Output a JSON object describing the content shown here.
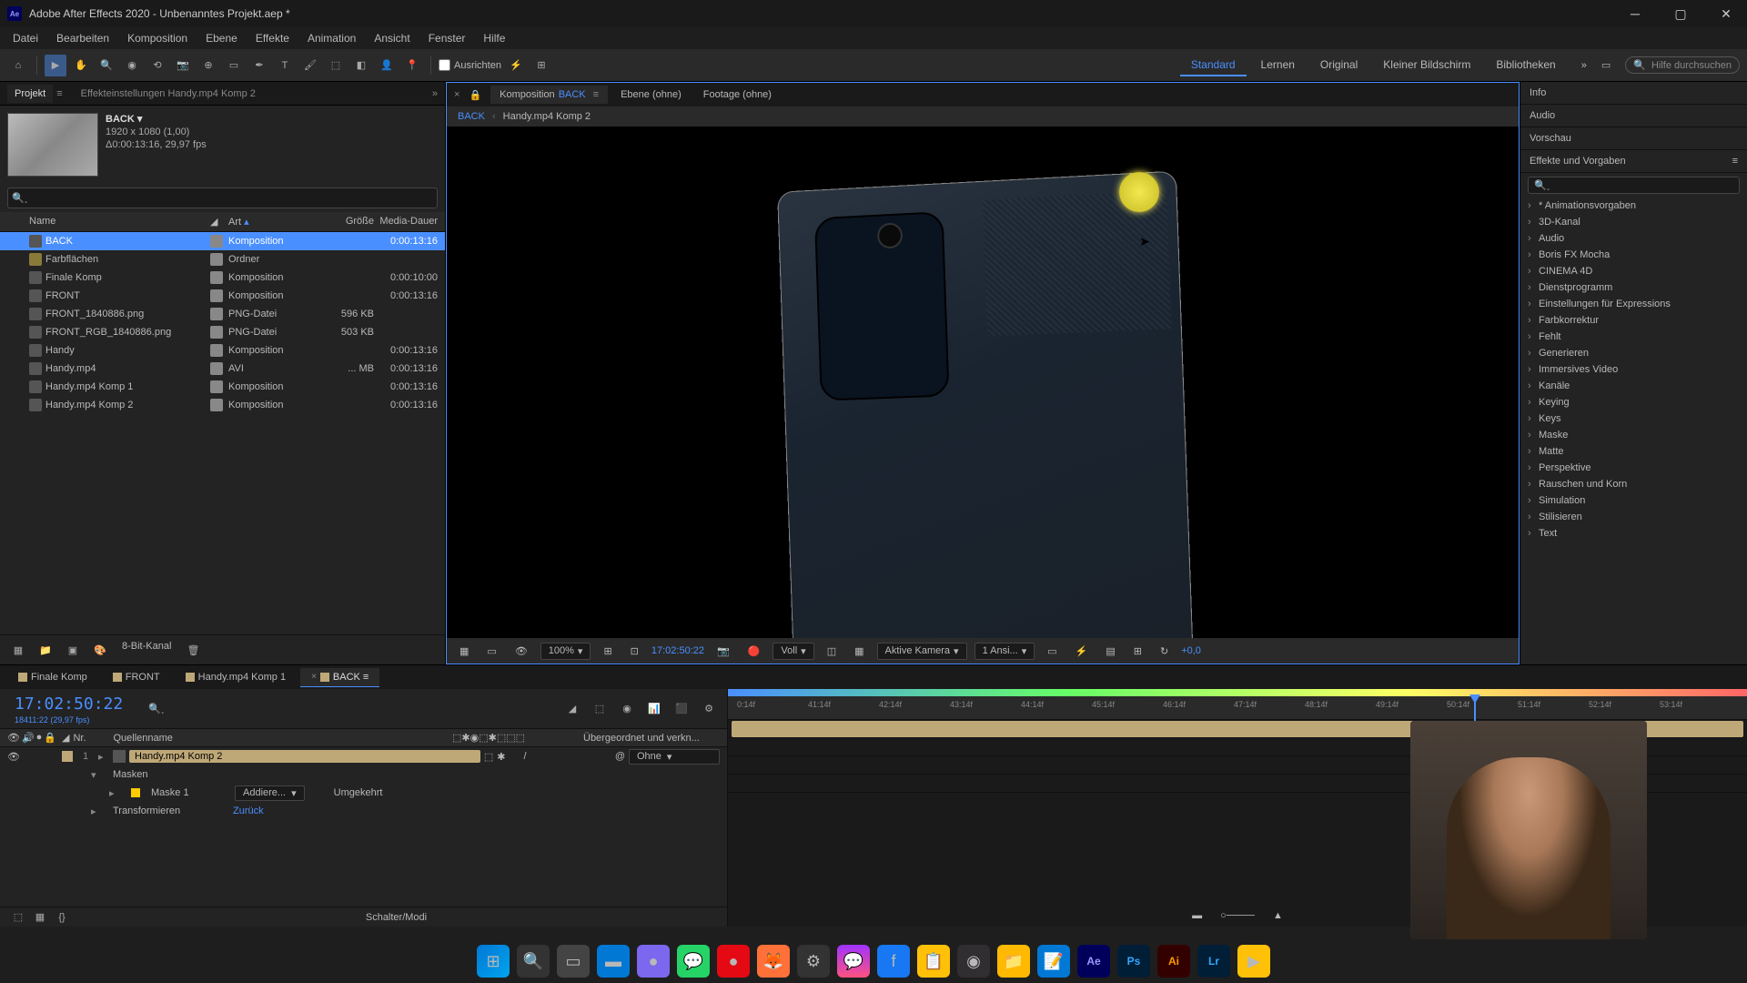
{
  "titlebar": {
    "app_initials": "Ae",
    "title": "Adobe After Effects 2020 - Unbenanntes Projekt.aep *"
  },
  "menu": [
    "Datei",
    "Bearbeiten",
    "Komposition",
    "Ebene",
    "Effekte",
    "Animation",
    "Ansicht",
    "Fenster",
    "Hilfe"
  ],
  "toolbar": {
    "align_label": "Ausrichten",
    "workspaces": [
      "Standard",
      "Lernen",
      "Original",
      "Kleiner Bildschirm",
      "Bibliotheken"
    ],
    "active_workspace": "Standard",
    "search_placeholder": "Hilfe durchsuchen"
  },
  "project_panel": {
    "tab": "Projekt",
    "effect_settings": "Effekteinstellungen  Handy.mp4 Komp 2",
    "selected": {
      "name": "BACK",
      "dims": "1920 x 1080 (1,00)",
      "dur": "Δ0:00:13:16, 29,97 fps"
    },
    "columns": {
      "name": "Name",
      "art": "Art",
      "size": "Größe",
      "dur": "Media-Dauer"
    },
    "items": [
      {
        "name": "BACK",
        "art": "Komposition",
        "size": "",
        "dur": "0:00:13:16",
        "selected": true,
        "icon": "comp"
      },
      {
        "name": "Farbflächen",
        "art": "Ordner",
        "size": "",
        "dur": "",
        "icon": "folder"
      },
      {
        "name": "Finale Komp",
        "art": "Komposition",
        "size": "",
        "dur": "0:00:10:00",
        "icon": "comp"
      },
      {
        "name": "FRONT",
        "art": "Komposition",
        "size": "",
        "dur": "0:00:13:16",
        "icon": "comp"
      },
      {
        "name": "FRONT_1840886.png",
        "art": "PNG-Datei",
        "size": "596 KB",
        "dur": "",
        "icon": "img"
      },
      {
        "name": "FRONT_RGB_1840886.png",
        "art": "PNG-Datei",
        "size": "503 KB",
        "dur": "",
        "icon": "img"
      },
      {
        "name": "Handy",
        "art": "Komposition",
        "size": "",
        "dur": "0:00:13:16",
        "icon": "comp"
      },
      {
        "name": "Handy.mp4",
        "art": "AVI",
        "size": "... MB",
        "dur": "0:00:13:16",
        "icon": "vid"
      },
      {
        "name": "Handy.mp4 Komp 1",
        "art": "Komposition",
        "size": "",
        "dur": "0:00:13:16",
        "icon": "comp"
      },
      {
        "name": "Handy.mp4 Komp 2",
        "art": "Komposition",
        "size": "",
        "dur": "0:00:13:16",
        "icon": "comp"
      }
    ],
    "bit_depth": "8-Bit-Kanal"
  },
  "composition": {
    "tabs": [
      {
        "label": "Komposition",
        "extra": "BACK",
        "active": true
      },
      {
        "label": "Ebene  (ohne)"
      },
      {
        "label": "Footage  (ohne)"
      }
    ],
    "breadcrumb": [
      "BACK",
      "Handy.mp4 Komp 2"
    ],
    "controls": {
      "zoom": "100%",
      "timecode": "17:02:50:22",
      "resolution": "Voll",
      "camera": "Aktive Kamera",
      "views": "1 Ansi...",
      "exposure": "+0,0"
    }
  },
  "right_panel": {
    "sections": [
      "Info",
      "Audio",
      "Vorschau"
    ],
    "effects_title": "Effekte und Vorgaben",
    "categories": [
      "* Animationsvorgaben",
      "3D-Kanal",
      "Audio",
      "Boris FX Mocha",
      "CINEMA 4D",
      "Dienstprogramm",
      "Einstellungen für Expressions",
      "Farbkorrektur",
      "Fehlt",
      "Generieren",
      "Immersives Video",
      "Kanäle",
      "Keying",
      "Keys",
      "Maske",
      "Matte",
      "Perspektive",
      "Rauschen und Korn",
      "Simulation",
      "Stilisieren",
      "Text"
    ]
  },
  "timeline": {
    "tabs": [
      "Finale Komp",
      "FRONT",
      "Handy.mp4 Komp 1",
      "BACK"
    ],
    "active_tab": 3,
    "timecode": "17:02:50:22",
    "framecount": "18411:22 (29,97 fps)",
    "columns": {
      "nr": "Nr.",
      "name": "Quellenname",
      "parent": "Übergeordnet und verkn..."
    },
    "layer": {
      "num": "1",
      "name": "Handy.mp4 Komp 2",
      "parent": "Ohne",
      "masks_label": "Masken",
      "mask_name": "Maske 1",
      "mask_mode": "Addiere...",
      "mask_inverted": "Umgekehrt",
      "transform_label": "Transformieren",
      "transform_reset": "Zurück"
    },
    "ruler_ticks": [
      "0:14f",
      "41:14f",
      "42:14f",
      "43:14f",
      "44:14f",
      "45:14f",
      "46:14f",
      "47:14f",
      "48:14f",
      "49:14f",
      "50:14f",
      "51:14f",
      "52:14f",
      "53:14f"
    ],
    "footer": "Schalter/Modi"
  }
}
